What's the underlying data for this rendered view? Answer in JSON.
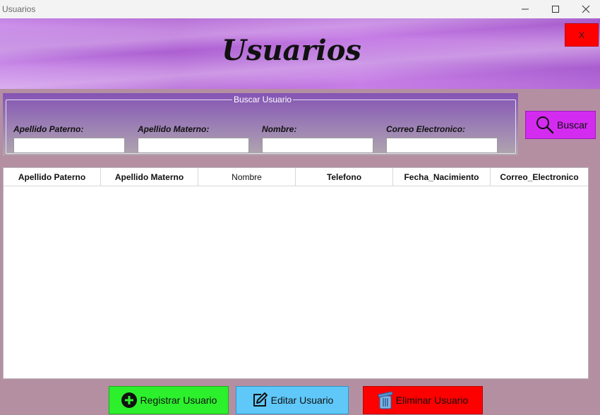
{
  "window": {
    "title": "Usuarios"
  },
  "header": {
    "title": "Usuarios",
    "close_label": "X"
  },
  "search": {
    "legend": "Buscar Usuario",
    "fields": [
      {
        "label": "Apellido Paterno:",
        "value": ""
      },
      {
        "label": "Apellido Materno:",
        "value": ""
      },
      {
        "label": "Nombre:",
        "value": ""
      },
      {
        "label": "Correo Electronico:",
        "value": ""
      }
    ],
    "button_label": "Buscar"
  },
  "table": {
    "columns": [
      "Apellido Paterno",
      "Apellido Materno",
      "Nombre",
      "Telefono",
      "Fecha_Nacimiento",
      "Correo_Electronico"
    ],
    "rows": []
  },
  "actions": {
    "register_label": "Registrar Usuario",
    "edit_label": "Editar Usuario",
    "delete_label": "Eliminar Usuario"
  },
  "icons": {
    "search": "magnifier-icon",
    "register": "plus-circle-icon",
    "edit": "edit-icon",
    "delete": "trash-icon"
  },
  "colors": {
    "buscar": "#d42bf0",
    "register": "#2df02d",
    "edit": "#5fc8f9",
    "delete": "#ff0000",
    "close": "#ff0000"
  }
}
